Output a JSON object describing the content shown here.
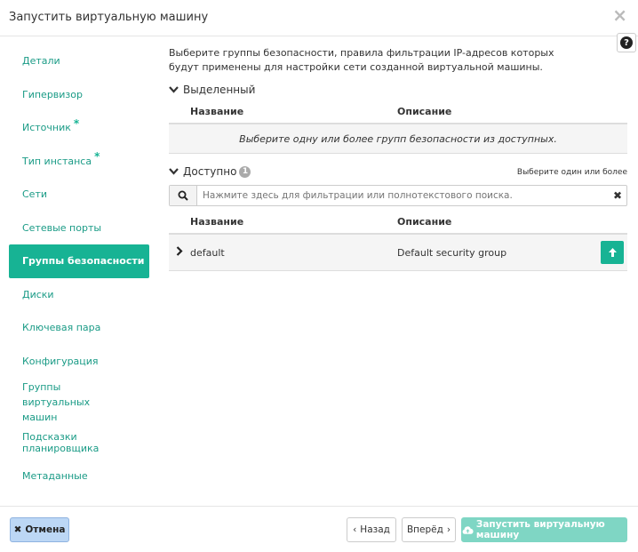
{
  "dialog": {
    "title": "Запустить виртуальную машину",
    "close_icon": "×",
    "help_icon": "?"
  },
  "sidebar": {
    "items": [
      {
        "label": "Детали",
        "required": false,
        "active": false
      },
      {
        "label": "Гипервизор",
        "required": false,
        "active": false
      },
      {
        "label": "Источник",
        "required": true,
        "active": false
      },
      {
        "label": "Тип инстанса",
        "required": true,
        "active": false
      },
      {
        "label": "Сети",
        "required": false,
        "active": false
      },
      {
        "label": "Сетевые порты",
        "required": false,
        "active": false
      },
      {
        "label": "Группы безопасности",
        "required": false,
        "active": true
      },
      {
        "label": "Диски",
        "required": false,
        "active": false
      },
      {
        "label": "Ключевая пара",
        "required": false,
        "active": false
      },
      {
        "label": "Конфигурация",
        "required": false,
        "active": false
      },
      {
        "label": "Группы виртуальных машин",
        "required": false,
        "active": false
      },
      {
        "label": "Подсказки планировщика",
        "required": false,
        "active": false
      },
      {
        "label": "Метаданные",
        "required": false,
        "active": false
      }
    ]
  },
  "main": {
    "description": "Выберите группы безопасности, правила фильтрации IP-адресов которых будут применены для настройки сети созданной виртуальной машины.",
    "allocated": {
      "title": "Выделенный",
      "col_name": "Название",
      "col_desc": "Описание",
      "empty": "Выберите одну или более групп безопасности из доступных."
    },
    "available": {
      "title": "Доступно",
      "count": "1",
      "select_hint": "Выберите один или более",
      "search_placeholder": "Нажмите здесь для фильтрации или полнотекстового поиска.",
      "col_name": "Название",
      "col_desc": "Описание",
      "rows": [
        {
          "name": "default",
          "description": "Default security group"
        }
      ]
    }
  },
  "footer": {
    "cancel": "Отмена",
    "back": "Назад",
    "next": "Вперёд",
    "launch": "Запустить виртуальную машину"
  },
  "colors": {
    "accent": "#17b394",
    "link": "#1a9b86",
    "cancel_bg": "#bcd7f5",
    "launch_bg": "#7fd6c4"
  }
}
